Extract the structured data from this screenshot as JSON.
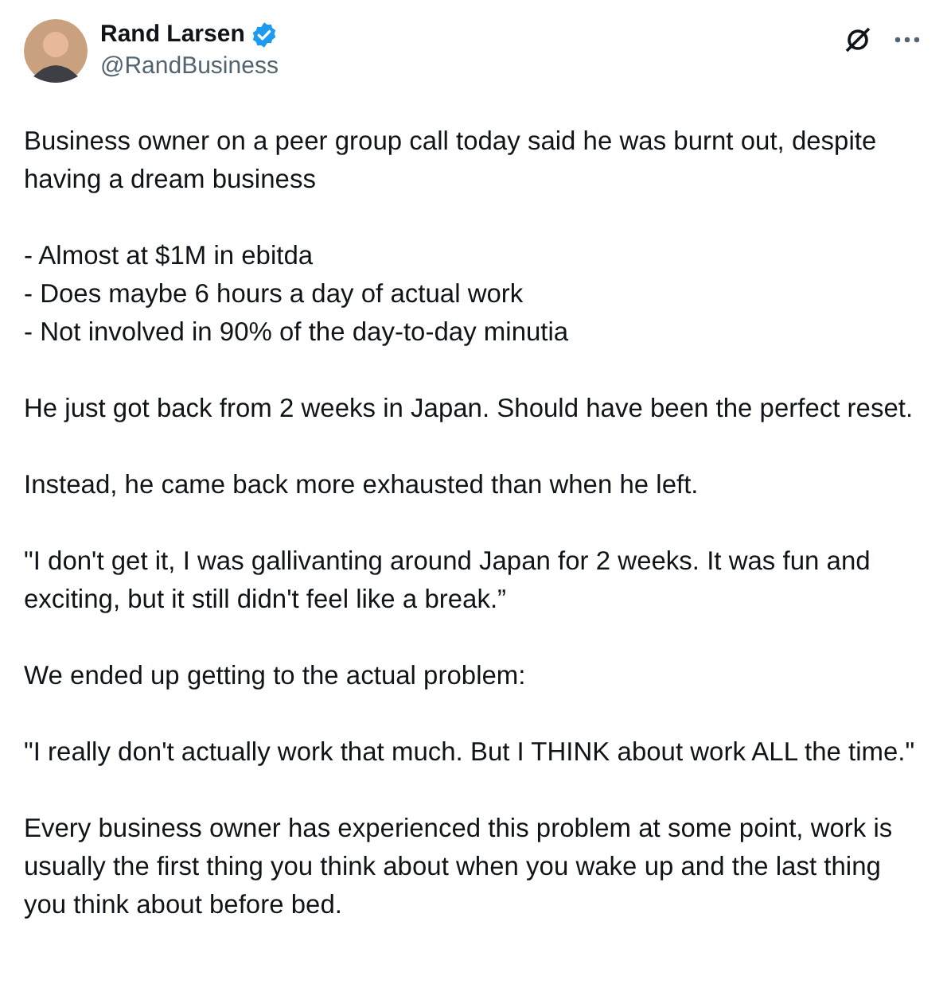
{
  "author": {
    "name": "Rand Larsen",
    "handle": "@RandBusiness",
    "verified": true
  },
  "paragraphs": [
    "Business owner on a peer group call today said he was burnt out, despite having a dream business",
    "- Almost at $1M in ebitda\n- Does maybe 6 hours a day of actual work\n- Not involved in 90% of the day-to-day minutia",
    "He just got back from 2 weeks in Japan. Should have been the perfect reset.",
    "Instead, he came back more exhausted than when he left.",
    "\"I don't get it, I was gallivanting around Japan for 2 weeks. It was fun and exciting, but it still didn't feel like a break.”",
    "We ended up getting to the actual problem:",
    "\"I really don't actually work that much. But I THINK about work ALL the time.\"",
    "Every business owner has experienced this problem at some point, work is usually the first thing you think about when you wake up and the last thing you think about before bed."
  ]
}
